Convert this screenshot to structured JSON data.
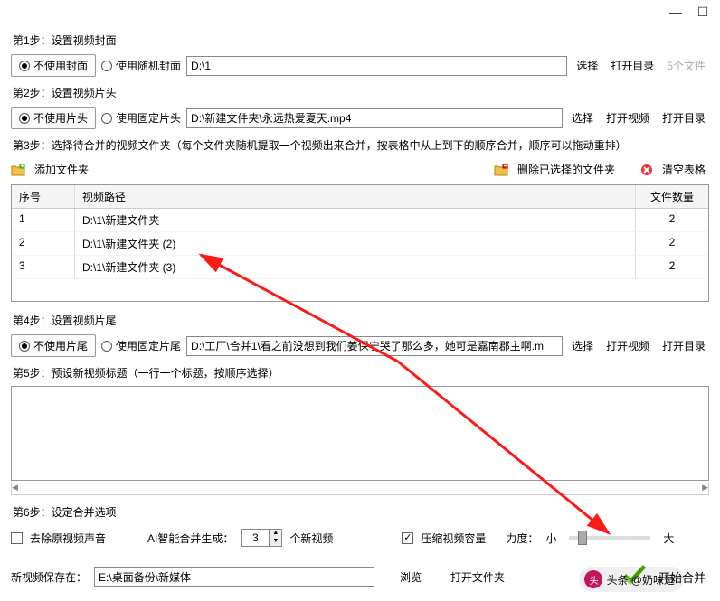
{
  "titlebar": {
    "min": "—",
    "max": "☐"
  },
  "step1": {
    "label": "第1步：设置视频封面",
    "opt_no_cover": "不使用封面",
    "opt_random": "使用随机封面",
    "path": "D:\\1",
    "btn_select": "选择",
    "btn_open": "打开目录",
    "file_count": "5个文件"
  },
  "step2": {
    "label": "第2步：设置视频片头",
    "opt_no_head": "不使用片头",
    "opt_fixed": "使用固定片头",
    "path": "D:\\新建文件夹\\永远热爱夏天.mp4",
    "btn_select": "选择",
    "btn_open": "打开视频",
    "btn_open_dir": "打开目录"
  },
  "step3": {
    "label": "第3步：选择待合并的视频文件夹（每个文件夹随机提取一个视频出来合并，按表格中从上到下的顺序合并，顺序可以拖动重排）",
    "add_folder": "添加文件夹",
    "delete_selected": "删除已选择的文件夹",
    "clear_table": "清空表格",
    "cols": {
      "seq": "序号",
      "path": "视频路径",
      "count": "文件数量"
    },
    "rows": [
      {
        "seq": "1",
        "path": "D:\\1\\新建文件夹",
        "count": "2"
      },
      {
        "seq": "2",
        "path": "D:\\1\\新建文件夹 (2)",
        "count": "2"
      },
      {
        "seq": "3",
        "path": "D:\\1\\新建文件夹 (3)",
        "count": "2"
      }
    ]
  },
  "step4": {
    "label": "第4步：设置视频片尾",
    "opt_no_tail": "不使用片尾",
    "opt_fixed": "使用固定片尾",
    "path": "D:\\工厂\\合并1\\看之前没想到我们姜保宁哭了那么多，她可是嘉南郡主啊.m",
    "btn_select": "选择",
    "btn_open": "打开视频",
    "btn_open_dir": "打开目录"
  },
  "step5": {
    "label": "第5步：预设新视频标题（一行一个标题，按顺序选择）"
  },
  "step6": {
    "label": "第6步：设定合并选项",
    "chk_remove_audio": "去除原视频声音",
    "ai_label": "AI智能合并生成：",
    "ai_value": "3",
    "ai_suffix": "个新视频",
    "chk_compress": "压缩视频容量",
    "strength_label": "力度：",
    "strength_small": "小",
    "strength_large": "大"
  },
  "save": {
    "label": "新视频保存在：",
    "path": "E:\\桌面备份\\新媒体",
    "btn_browse": "浏览",
    "btn_open": "打开文件夹",
    "btn_start": "开始合并"
  },
  "watermark": {
    "text": "头条 @奶味逗"
  }
}
